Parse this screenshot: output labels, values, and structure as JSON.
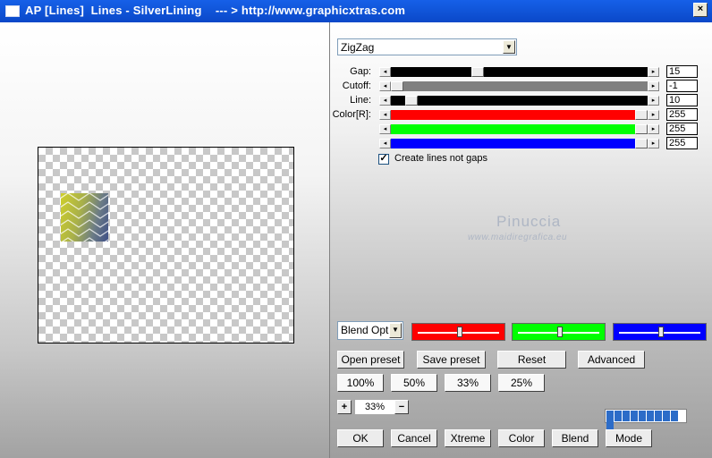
{
  "window": {
    "title": "AP [Lines]  Lines - SilverLining    --- > http://www.graphicxtras.com",
    "close_glyph": "×"
  },
  "preset_dropdown": {
    "value": "ZigZag",
    "arrow": "▼"
  },
  "sliders": [
    {
      "label": "Gap:",
      "value": "15",
      "fill_color": "#000000",
      "position": 0.33
    },
    {
      "label": "Cutoff:",
      "value": "-1",
      "fill_color": "#808080",
      "position": 0.0
    },
    {
      "label": "Line:",
      "value": "10",
      "fill_color": "#000000",
      "position": 0.06
    },
    {
      "label": "Color[R]:",
      "value": "255",
      "fill_color": "#ff0000",
      "position": 1.0
    },
    {
      "label": "",
      "value": "255",
      "fill_color": "#00ff00",
      "position": 1.0
    },
    {
      "label": "",
      "value": "255",
      "fill_color": "#0000ff",
      "position": 1.0
    }
  ],
  "slider_arrows": {
    "left": "◂",
    "right": "▸"
  },
  "create_lines_checkbox": {
    "label": "Create lines not gaps",
    "checked": true,
    "mark": "✓"
  },
  "watermark": {
    "name": "Pinuccia",
    "url": "www.maidiregrafica.eu"
  },
  "blend_dropdown": {
    "value": "Blend Optio",
    "arrow": "▼"
  },
  "color_boxes": [
    {
      "color": "#ff0000",
      "position": 0.5
    },
    {
      "color": "#00ff00",
      "position": 0.5
    },
    {
      "color": "#0000ff",
      "position": 0.5
    }
  ],
  "buttons": {
    "open_preset": "Open preset",
    "save_preset": "Save preset",
    "reset": "Reset",
    "advanced": "Advanced",
    "zoom100": "100%",
    "zoom50": "50%",
    "zoom33": "33%",
    "zoom25": "25%",
    "ok": "OK",
    "cancel": "Cancel",
    "xtreme": "Xtreme",
    "color": "Color",
    "blend": "Blend",
    "mode": "Mode"
  },
  "zoom": {
    "plus": "+",
    "minus": "−",
    "value": "33%"
  },
  "progress": {
    "segments": 10,
    "fraction": 1.0,
    "color": "#2c6cc8"
  }
}
